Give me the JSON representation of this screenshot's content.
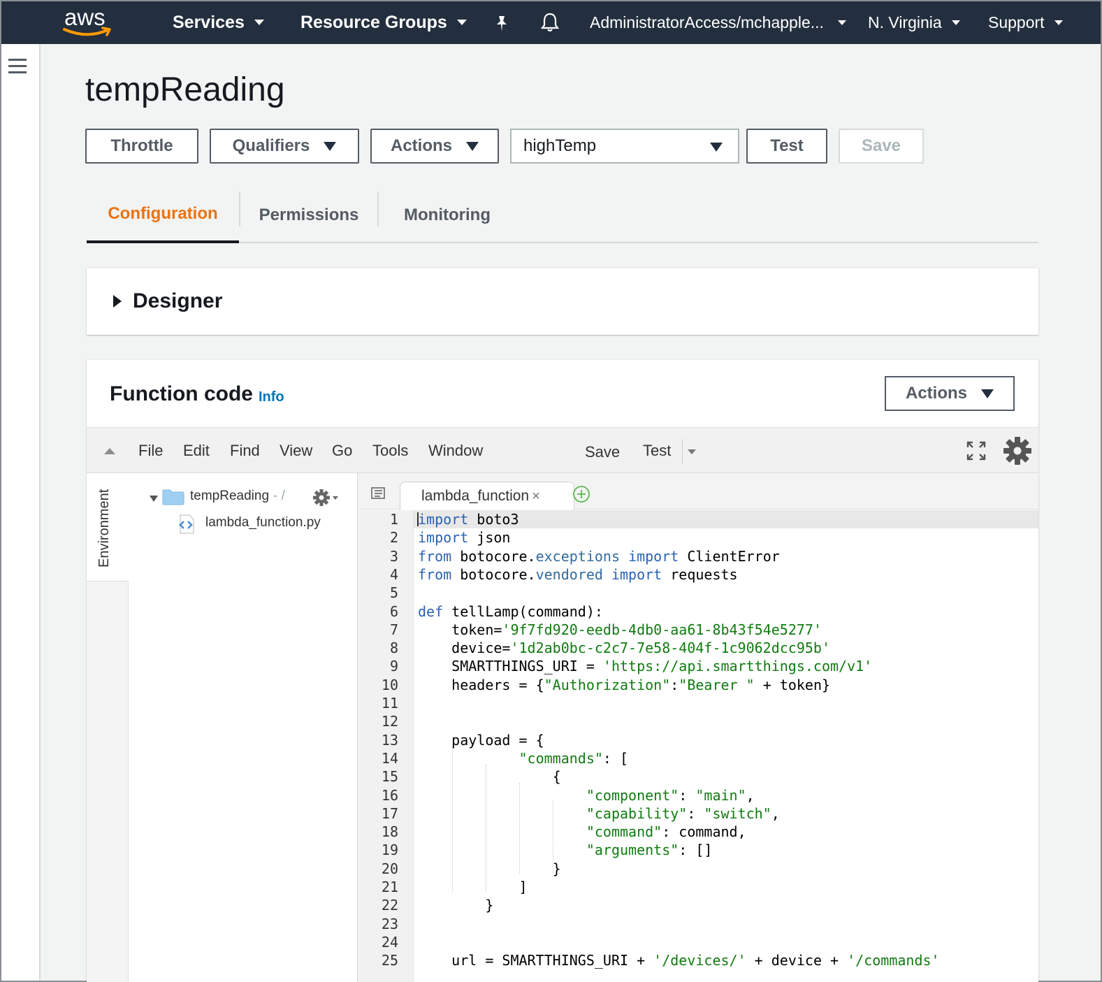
{
  "topnav": {
    "logo_text": "aws",
    "services": "Services",
    "resource_groups": "Resource Groups",
    "account": "AdministratorAccess/mchapple...",
    "region": "N. Virginia",
    "support": "Support"
  },
  "page": {
    "title": "tempReading"
  },
  "toolbar": {
    "throttle": "Throttle",
    "qualifiers": "Qualifiers",
    "actions": "Actions",
    "test_event": "highTemp",
    "test": "Test",
    "save": "Save"
  },
  "tabs": [
    "Configuration",
    "Permissions",
    "Monitoring"
  ],
  "designer": {
    "label": "Designer"
  },
  "function_code": {
    "heading": "Function code",
    "info": "Info",
    "actions": "Actions"
  },
  "ide": {
    "menu": [
      "File",
      "Edit",
      "Find",
      "View",
      "Go",
      "Tools",
      "Window"
    ],
    "save": "Save",
    "test": "Test",
    "environment_label": "Environment",
    "folder": "tempReading",
    "folder_suffix": "- /",
    "file": "lambda_function.py",
    "editor_tab": "lambda_function",
    "editor_tab_close": "×"
  },
  "code_lines": [
    "import boto3",
    "import json",
    "from botocore.exceptions import ClientError",
    "from botocore.vendored import requests",
    "",
    "def tellLamp(command):",
    "    token='9f7fd920-eedb-4db0-aa61-8b43f54e5277'",
    "    device='1d2ab0bc-c2c7-7e58-404f-1c9062dcc95b'",
    "    SMARTTHINGS_URI = 'https://api.smartthings.com/v1'",
    "    headers = {\"Authorization\":\"Bearer \" + token}",
    "",
    "",
    "    payload = {",
    "            \"commands\": [",
    "                {",
    "                    \"component\": \"main\",",
    "                    \"capability\": \"switch\",",
    "                    \"command\": command,",
    "                    \"arguments\": []",
    "                }",
    "            ]",
    "        }",
    "",
    "",
    "    url = SMARTTHINGS_URI + '/devices/' + device + '/commands'"
  ],
  "colors": {
    "nav_bg": "#232f3e",
    "active_tab": "#ec7211",
    "info_link": "#0073bb",
    "keyword": "#0000cd",
    "string": "#107b10"
  }
}
